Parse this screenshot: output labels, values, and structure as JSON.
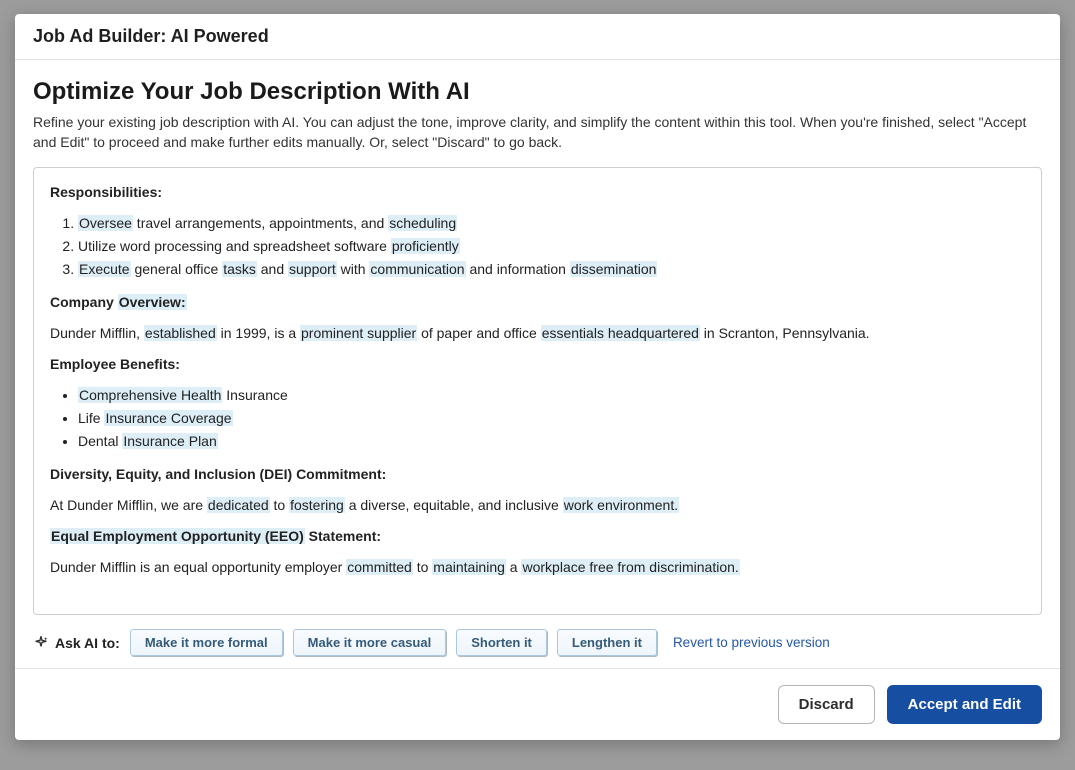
{
  "modal": {
    "title": "Job Ad Builder: AI Powered",
    "intro": {
      "heading": "Optimize Your Job Description With AI",
      "text": "Refine your existing job description with AI. You can adjust the tone, improve clarity, and simplify the content within this tool. When you're finished, select \"Accept and Edit\" to proceed and make further edits manually. Or, select \"Discard\" to go back."
    },
    "content": {
      "responsibilities_label": "Responsibilities:",
      "resp_items": {
        "r1_a": "Oversee",
        "r1_b": " travel arrangements, appointments, and ",
        "r1_c": "scheduling",
        "r2_a": "Utilize word processing and spreadsheet software ",
        "r2_b": "proficiently",
        "r3_a": "Execute",
        "r3_b": " general office ",
        "r3_c": "tasks",
        "r3_d": " and ",
        "r3_e": "support",
        "r3_f": " with ",
        "r3_g": "communication",
        "r3_h": " and information ",
        "r3_i": "dissemination"
      },
      "company_label_a": "Company ",
      "company_label_b": "Overview:",
      "company_text": {
        "a": "Dunder Mifflin, ",
        "b": "established",
        "c": " in 1999, is a ",
        "d": "prominent supplier",
        "e": " of paper and office ",
        "f": "essentials headquartered",
        "g": " in Scranton, Pennsylvania."
      },
      "benefits_label": "Employee Benefits:",
      "benefits": {
        "b1_a": "Comprehensive Health",
        "b1_b": " Insurance",
        "b2_a": "Life ",
        "b2_b": "Insurance Coverage",
        "b3_a": "Dental ",
        "b3_b": "Insurance Plan"
      },
      "dei_label": "Diversity, Equity, and Inclusion (DEI) Commitment:",
      "dei_text": {
        "a": "At Dunder Mifflin, we are ",
        "b": "dedicated",
        "c": " to ",
        "d": "fostering",
        "e": " a diverse, equitable, and inclusive ",
        "f": "work environment."
      },
      "eeo_label_a": "Equal Employment Opportunity (EEO)",
      "eeo_label_b": " Statement:",
      "eeo_text": {
        "a": "Dunder Mifflin is an equal opportunity employer ",
        "b": "committed",
        "c": " to ",
        "d": "maintaining",
        "e": " a ",
        "f": "workplace free from discrimination."
      }
    },
    "ai_row": {
      "label": "Ask AI to:",
      "chips": {
        "formal": "Make it more formal",
        "casual": "Make it more casual",
        "shorten": "Shorten it",
        "lengthen": "Lengthen it"
      },
      "revert": "Revert to previous version"
    },
    "footer": {
      "discard": "Discard",
      "accept": "Accept and Edit"
    }
  }
}
